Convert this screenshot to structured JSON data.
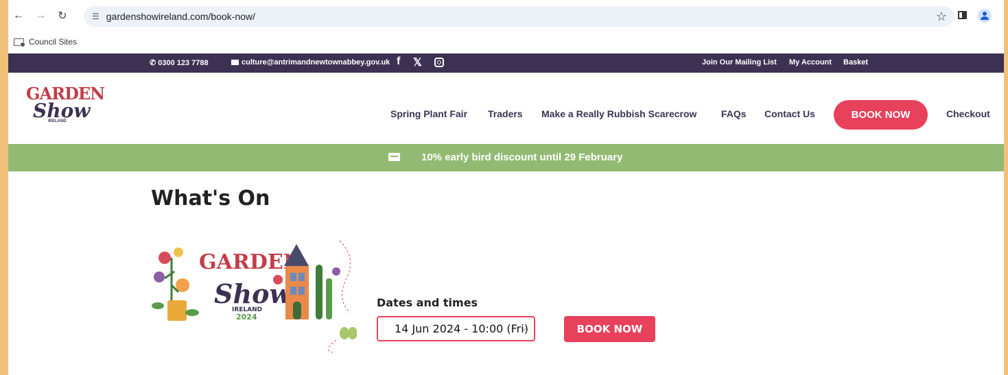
{
  "browser": {
    "url": "gardenshowireland.com/book-now/",
    "bookmarks": [
      {
        "label": "Council Sites"
      }
    ]
  },
  "topbar": {
    "phone": "0300 123 7788",
    "email": "culture@antrimandnewtownabbey.gov.uk",
    "social": [
      "f",
      "𝕏"
    ],
    "links": [
      "Join Our Mailing List",
      "My Account",
      "Basket"
    ]
  },
  "logo": {
    "line1": "GARDEN",
    "line2": "Show",
    "line3": "IRELAND"
  },
  "nav": {
    "items": [
      "Spring Plant Fair",
      "Traders",
      "Make a Really Rubbish Scarecrow",
      "FAQs",
      "Contact Us"
    ],
    "book_now": "BOOK NOW",
    "checkout": "Checkout"
  },
  "promo": {
    "text": "10% early bird discount until 29 February"
  },
  "main": {
    "heading": "What's On",
    "event_image": {
      "line1": "GARDEN",
      "line2": "Show",
      "line3": "IRELAND",
      "line4": "2024"
    },
    "dates_label": "Dates and times",
    "selected_date": "14 Jun 2024 - 10:00 (Fri)",
    "book_now": "BOOK NOW"
  },
  "colors": {
    "accent": "#e8415b",
    "topbar": "#3c3152",
    "promo": "#93ba73",
    "frame": "#f1c17a"
  }
}
